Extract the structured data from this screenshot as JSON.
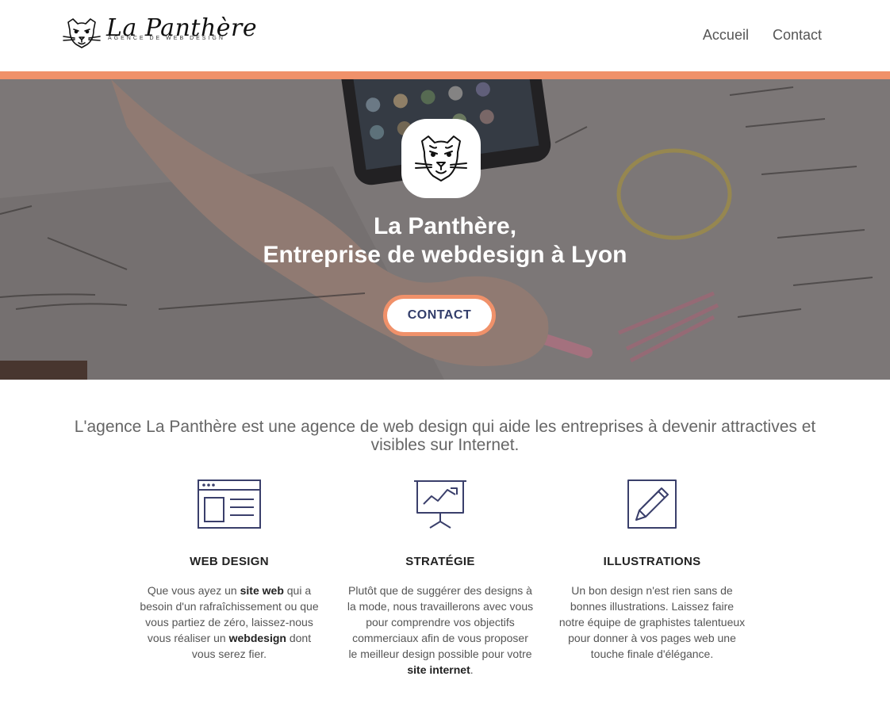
{
  "brand": {
    "name": "La Panthère",
    "tagline": "AGENCE DE WEB DESIGN"
  },
  "nav": {
    "items": [
      "Accueil",
      "Contact"
    ]
  },
  "colors": {
    "accent": "#f0916a",
    "button_text": "#333e6b",
    "icon_stroke": "#3a3f6b"
  },
  "hero": {
    "title_line1": "La Panthère,",
    "title_line2": "Entreprise de webdesign à Lyon",
    "cta_label": "CONTACT"
  },
  "intro": {
    "text": "L'agence La Panthère est une agence de web design qui aide les entreprises à devenir attractives et visibles sur Internet."
  },
  "services": [
    {
      "icon": "browser-window-icon",
      "title": "WEB DESIGN",
      "body": [
        {
          "t": "Que vous ayez un "
        },
        {
          "t": "site web",
          "b": true
        },
        {
          "t": " qui a besoin d'un rafraîchissement ou que vous partiez de zéro, laissez-nous vous réaliser un "
        },
        {
          "t": "webdesign",
          "b": true
        },
        {
          "t": " dont vous serez fier."
        }
      ]
    },
    {
      "icon": "presentation-chart-icon",
      "title": "STRATÉGIE",
      "body": [
        {
          "t": "Plutôt que de suggérer des designs à la mode, nous travaillerons avec vous pour comprendre vos objectifs commerciaux afin de vous proposer le meilleur design possible pour votre "
        },
        {
          "t": "site internet",
          "b": true
        },
        {
          "t": "."
        }
      ]
    },
    {
      "icon": "pencil-icon",
      "title": "ILLUSTRATIONS",
      "body": [
        {
          "t": "Un bon design n'est rien sans de bonnes illustrations. Laissez faire notre équipe de graphistes talentueux pour donner à vos pages web une touche finale d'élégance."
        }
      ]
    }
  ]
}
